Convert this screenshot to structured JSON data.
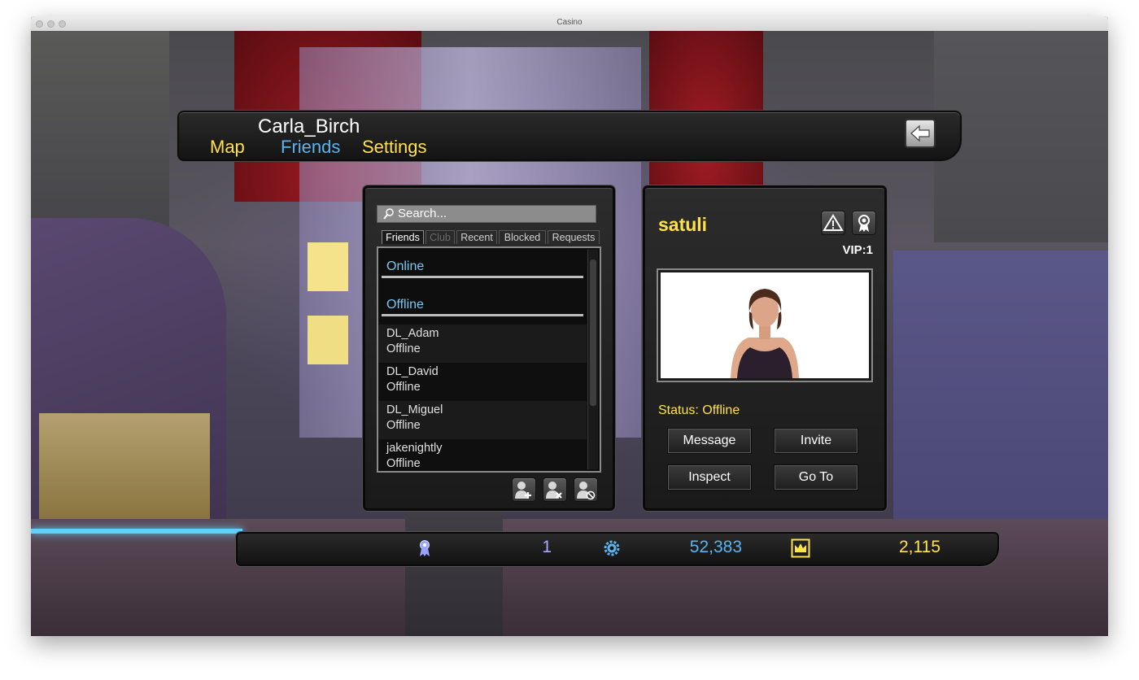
{
  "window": {
    "title": "Casino"
  },
  "header": {
    "username": "Carla_Birch",
    "nav": {
      "map": "Map",
      "friends": "Friends",
      "settings": "Settings"
    }
  },
  "friends_panel": {
    "search_placeholder": "Search...",
    "tabs": [
      "Friends",
      "Club",
      "Recent",
      "Blocked",
      "Requests"
    ],
    "sections": {
      "online": "Online",
      "offline": "Offline"
    },
    "friends": [
      {
        "name": "DL_Adam",
        "status": "Offline"
      },
      {
        "name": "DL_David",
        "status": "Offline"
      },
      {
        "name": "DL_Miguel",
        "status": "Offline"
      },
      {
        "name": "jakenightly",
        "status": "Offline"
      }
    ]
  },
  "profile_panel": {
    "name": "satuli",
    "vip": "VIP:1",
    "status_label": "Status:",
    "status_value": "Offline",
    "buttons": {
      "message": "Message",
      "invite": "Invite",
      "inspect": "Inspect",
      "goto": "Go To"
    }
  },
  "stats": {
    "level": "1",
    "chips": "52,383",
    "crowns": "2,115"
  },
  "colors": {
    "gold": "#ffe24a",
    "blue": "#7ac8f0",
    "accent_blue": "#5ab4ee"
  }
}
